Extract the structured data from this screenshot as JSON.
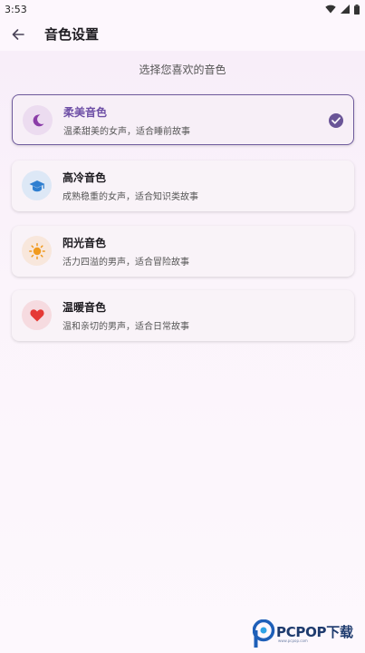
{
  "status_bar": {
    "time": "3:53"
  },
  "app_bar": {
    "title": "音色设置"
  },
  "subtitle": "选择您喜欢的音色",
  "voices": [
    {
      "title": "柔美音色",
      "desc": "温柔甜美的女声，适合睡前故事",
      "icon": "moon-icon",
      "icon_bg": "#ecdcf0",
      "icon_color": "#8b3da8",
      "selected": true
    },
    {
      "title": "高冷音色",
      "desc": "成熟稳重的女声，适合知识类故事",
      "icon": "graduation-cap-icon",
      "icon_bg": "#dde8f6",
      "icon_color": "#2f7fd0",
      "selected": false
    },
    {
      "title": "阳光音色",
      "desc": "活力四溢的男声，适合冒险故事",
      "icon": "sun-icon",
      "icon_bg": "#f8e7dc",
      "icon_color": "#f09a1e",
      "selected": false
    },
    {
      "title": "温暖音色",
      "desc": "温和亲切的男声，适合日常故事",
      "icon": "heart-icon",
      "icon_bg": "#f6dbe0",
      "icon_color": "#e53935",
      "selected": false
    }
  ],
  "watermark": {
    "text": "PCPOP下载",
    "sub": "www.pcpop.com"
  },
  "colors": {
    "accent": "#6a5597",
    "background": "#fdf7fd"
  }
}
